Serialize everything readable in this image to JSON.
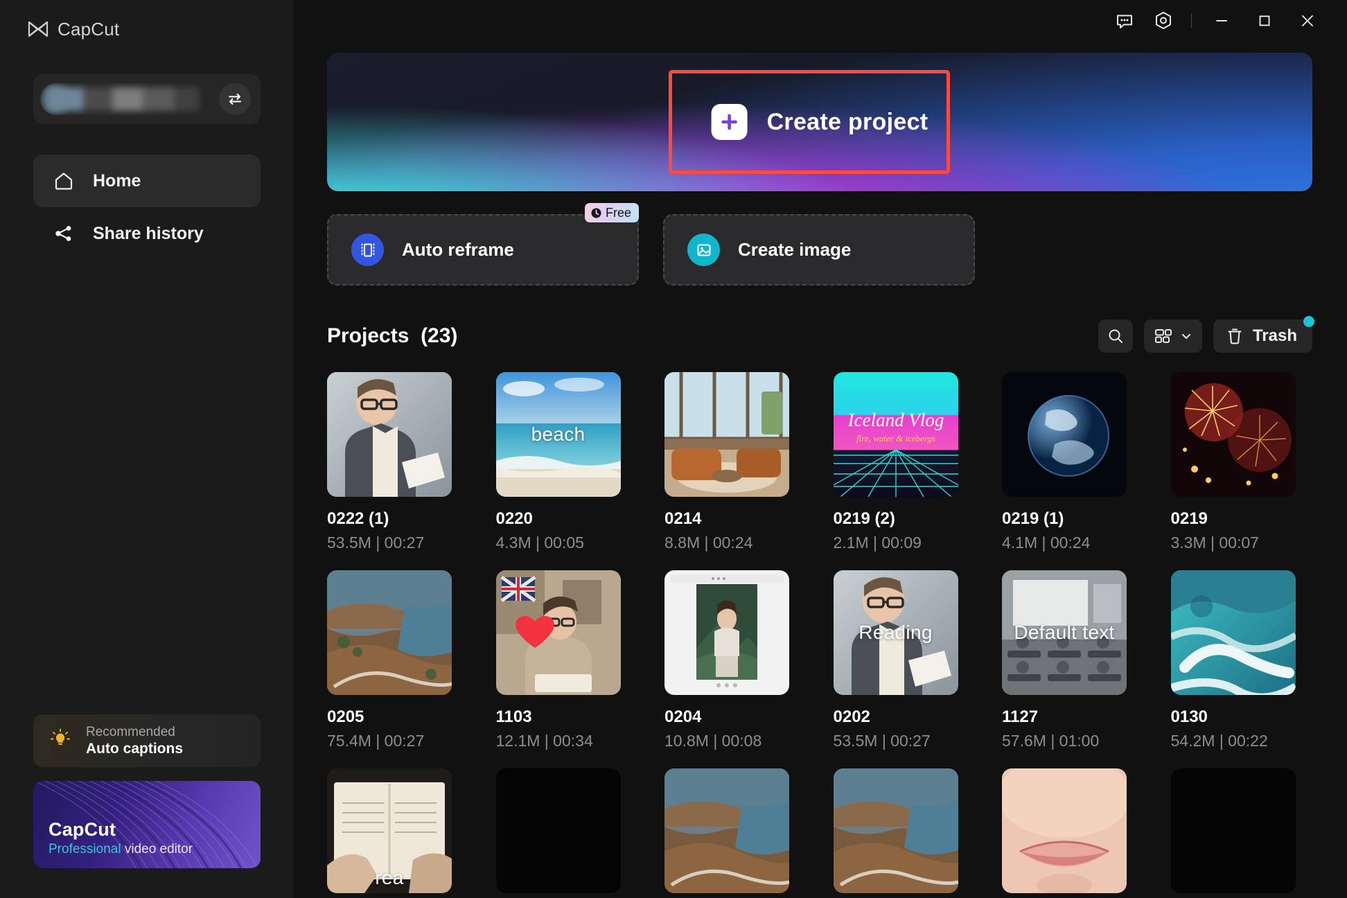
{
  "app": {
    "brand": "CapCut"
  },
  "titlebar": {
    "feedback_icon": "chat-bubble-icon",
    "settings_icon": "hex-gear-icon",
    "minimize_label": "Minimize",
    "maximize_label": "Maximize",
    "close_label": "Close"
  },
  "account": {
    "swap_icon": "switch-account-icon",
    "name_masked": ""
  },
  "sidebar": {
    "items": [
      {
        "label": "Home",
        "icon": "home-icon",
        "active": true
      },
      {
        "label": "Share history",
        "icon": "share-icon",
        "active": false
      }
    ],
    "recommended": {
      "kicker": "Recommended",
      "title": "Auto captions",
      "icon": "lightbulb-icon"
    },
    "promo": {
      "title": "CapCut",
      "subtitle_accent": "Professional",
      "subtitle_rest": " video editor"
    }
  },
  "hero": {
    "create_label": "Create project",
    "plus_icon": "plus-icon",
    "highlight_color": "#ff4b3e"
  },
  "actions": [
    {
      "label": "Auto reframe",
      "icon": "auto-reframe-icon",
      "icon_color": "#3355e0",
      "badge": "Free",
      "badge_icon": "clock-icon"
    },
    {
      "label": "Create image",
      "icon": "image-icon",
      "icon_color": "#11b5ce",
      "badge": null,
      "badge_icon": null
    }
  ],
  "projects": {
    "title": "Projects",
    "count": "(23)",
    "search_icon": "search-icon",
    "view_icon": "grid-view-icon",
    "view_chevron": "chevron-down-icon",
    "trash_label": "Trash",
    "trash_icon": "trash-icon",
    "has_badge": true,
    "badge_color": "#19c5d6",
    "items": [
      {
        "name": "0222 (1)",
        "meta": "53.5M | 00:27",
        "overlay": "",
        "thumb": "man-reading-document"
      },
      {
        "name": "0220",
        "meta": "4.3M | 00:05",
        "overlay": "beach",
        "thumb": "beach-sea"
      },
      {
        "name": "0214",
        "meta": "8.8M | 00:24",
        "overlay": "",
        "thumb": "living-room-interior"
      },
      {
        "name": "0219 (2)",
        "meta": "2.1M | 00:09",
        "overlay": "Iceland Vlog",
        "thumb": "neon-retro-grid"
      },
      {
        "name": "0219 (1)",
        "meta": "4.1M | 00:24",
        "overlay": "",
        "thumb": "earth-from-space"
      },
      {
        "name": "0219",
        "meta": "3.3M | 00:07",
        "overlay": "",
        "thumb": "fireworks"
      },
      {
        "name": "0205",
        "meta": "75.4M | 00:27",
        "overlay": "",
        "thumb": "coastal-cliff-road"
      },
      {
        "name": "1103",
        "meta": "12.1M | 00:34",
        "overlay": "",
        "thumb": "woman-reading-heart"
      },
      {
        "name": "0204",
        "meta": "10.8M | 00:08",
        "overlay": "",
        "thumb": "phone-ui-woman"
      },
      {
        "name": "0202",
        "meta": "53.5M | 00:27",
        "overlay": "Reading",
        "thumb": "man-reading-document"
      },
      {
        "name": "1127",
        "meta": "57.6M | 01:00",
        "overlay": "Default text",
        "thumb": "classroom"
      },
      {
        "name": "0130",
        "meta": "54.2M | 00:22",
        "overlay": "",
        "thumb": "ocean-waves-aerial"
      },
      {
        "name": "",
        "meta": "",
        "overlay": "rea",
        "thumb": "hands-book"
      },
      {
        "name": "",
        "meta": "",
        "overlay": "",
        "thumb": "black"
      },
      {
        "name": "",
        "meta": "",
        "overlay": "",
        "thumb": "coastal-cliff-road"
      },
      {
        "name": "",
        "meta": "",
        "overlay": "",
        "thumb": "coastal-cliff-road"
      },
      {
        "name": "",
        "meta": "",
        "overlay": "",
        "thumb": "lips-closeup"
      },
      {
        "name": "",
        "meta": "",
        "overlay": "",
        "thumb": "black"
      }
    ]
  }
}
